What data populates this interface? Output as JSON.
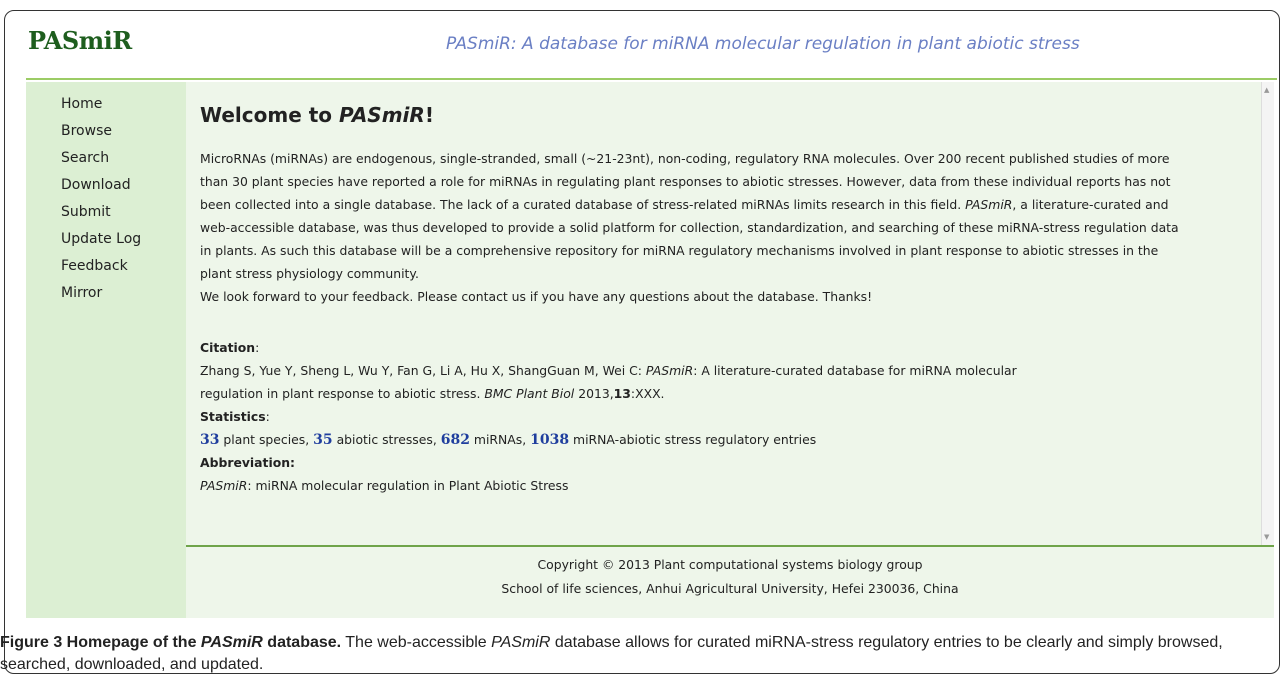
{
  "header": {
    "logo": "PASmiR",
    "slogan": "PASmiR: A database for miRNA molecular regulation in plant abiotic stress"
  },
  "nav": {
    "items": [
      "Home",
      "Browse",
      "Search",
      "Download",
      "Submit",
      "Update Log",
      "Feedback",
      "Mirror"
    ]
  },
  "welcome": {
    "prefix": "Welcome to ",
    "name": "PASmiR",
    "suffix": "!"
  },
  "intro": {
    "p1_a": "MicroRNAs (miRNAs) are endogenous, single-stranded, small (~21-23nt), non-coding, regulatory RNA molecules. Over 200 recent published studies of more than 30 plant species have reported a role for miRNAs in regulating plant responses to abiotic stresses. However, data from these individual reports has not been collected into a single database. The lack of a curated database of stress-related miRNAs limits research in this field. ",
    "p1_name": "PASmiR",
    "p1_b": ", a literature-curated and web-accessible database, was thus developed to provide a solid platform for collection, standardization, and searching of these miRNA-stress regulation data in plants. As such this database will be a comprehensive repository for miRNA regulatory mechanisms involved in plant response to abiotic stresses in the plant stress physiology community.",
    "p2": "We look forward to your feedback. Please contact us if you have any questions about the database. Thanks!"
  },
  "citation": {
    "label": "Citation",
    "colon": ":",
    "authors": "Zhang S, Yue Y, Sheng L, Wu Y, Fan G, Li A, Hu X, ShangGuan M, Wei C: ",
    "name": "PASmiR",
    "title_rest": ": A literature-curated database for miRNA molecular",
    "line2_a": "regulation in plant response to abiotic stress. ",
    "journal": "BMC Plant Biol",
    "year": " 2013,",
    "volume": "13",
    "pages": ":XXX."
  },
  "statistics": {
    "label": "Statistics",
    "colon": ":",
    "species_count": "33",
    "species_label": " plant species, ",
    "stress_count": "35",
    "stress_label": " abiotic stresses, ",
    "mirna_count": "682",
    "mirna_label": " miRNAs, ",
    "entries_count": "1038",
    "entries_label": " miRNA-abiotic stress regulatory entries"
  },
  "abbreviation": {
    "label": "Abbreviation:",
    "name": "PASmiR",
    "rest": ": miRNA molecular regulation in Plant Abiotic Stress"
  },
  "footer": {
    "copyright": "Copyright © 2013 Plant computational systems biology group",
    "address": "School of life sciences, Anhui Agricultural University, Hefei 230036, China"
  },
  "caption": {
    "fig": "Figure 3 Homepage of the ",
    "name": "PASmiR",
    "fig_end": " database.",
    "text_a": " The web-accessible ",
    "text_name": "PASmiR",
    "text_b": " database allows for curated miRNA-stress regulatory entries to be clearly and simply browsed, searched, downloaded, and updated."
  },
  "colors": {
    "logo": "#1e5e1e",
    "slogan": "#6a7fc4",
    "sidebar_bg": "#dcefd3",
    "content_bg": "#eef6ea",
    "accent_line": "#9ccc65",
    "stat_number": "#1f3e9e"
  }
}
